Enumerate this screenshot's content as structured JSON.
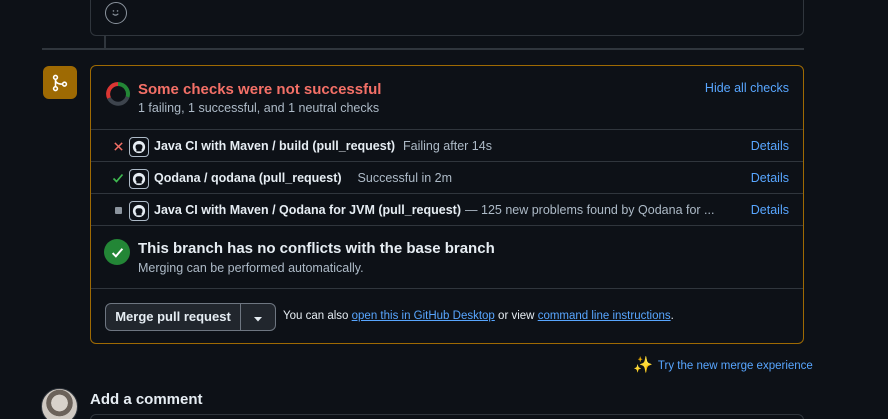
{
  "checks_panel": {
    "title": "Some checks were not successful",
    "subtitle": "1 failing, 1 successful, and 1 neutral checks",
    "hide_link": "Hide all checks",
    "rows": [
      {
        "name": "Java CI with Maven / build (pull_request)",
        "desc": "Failing after 14s",
        "status": "failure",
        "details": "Details"
      },
      {
        "name": "Qodana / qodana (pull_request)",
        "desc": "Successful in 2m",
        "status": "success",
        "details": "Details"
      },
      {
        "name": "Java CI with Maven / Qodana for JVM (pull_request)",
        "desc": "— 125 new problems found by Qodana for ...",
        "status": "neutral",
        "details": "Details"
      }
    ]
  },
  "conflicts": {
    "title": "This branch has no conflicts with the base branch",
    "subtitle": "Merging can be performed automatically."
  },
  "merge": {
    "button_label": "Merge pull request",
    "note_prefix": "You can also",
    "desktop_link": "open this in GitHub Desktop",
    "note_middle": "or view",
    "cli_link": "command line instructions",
    "note_suffix": "."
  },
  "try_new": "Try the new merge experience",
  "comment": {
    "heading": "Add a comment"
  },
  "colors": {
    "warning": "#9e6a03",
    "danger": "#f47067",
    "success": "#238636",
    "link": "#58a6ff"
  },
  "icons": {
    "merge": "git-merge-icon",
    "emoji": "smiley-icon",
    "failure": "x-icon",
    "success": "check-icon",
    "neutral": "square-icon",
    "app": "github-icon"
  }
}
